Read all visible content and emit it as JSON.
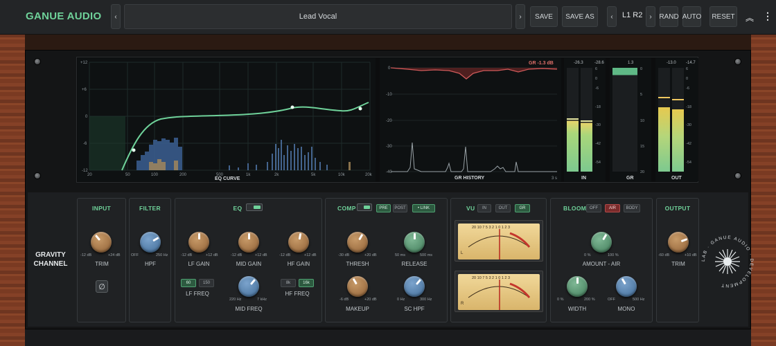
{
  "brand": "GANUE AUDIO",
  "preset": {
    "name": "Lead Vocal",
    "prev": "‹",
    "next": "›"
  },
  "toolbar": {
    "save": "SAVE",
    "save_as": "SAVE AS",
    "slot": "L1 R2",
    "slot_prev": "‹",
    "slot_next": "›",
    "rand": "RAND",
    "auto": "AUTO",
    "reset": "RESET",
    "collapse": "︽",
    "menu": "⋮"
  },
  "eq_curve": {
    "label": "EQ CURVE",
    "y_labels": [
      "+12",
      "+6",
      "0",
      "-6",
      "-12"
    ],
    "x_labels": [
      "20",
      "50",
      "100",
      "200",
      "500",
      "1k",
      "2k",
      "5k",
      "10k",
      "20k"
    ]
  },
  "gr_history": {
    "label": "GR HISTORY",
    "readout": "GR -1.3 dB",
    "y_labels": [
      "0",
      "-10",
      "-20",
      "-30",
      "-40"
    ],
    "x_end": "3 s"
  },
  "meters": {
    "in": {
      "label": "IN",
      "peak_l": "-26.3",
      "peak_r": "-28.6",
      "level_l": 0.49,
      "level_r": 0.47
    },
    "gr": {
      "label": "GR",
      "peak": "1.3",
      "level": 0.07
    },
    "out": {
      "label": "OUT",
      "peak_l": "-13.0",
      "peak_r": "-14.7",
      "level_l": 0.62,
      "level_r": 0.6
    },
    "scale_db": [
      "6",
      "0",
      "-6",
      "-18",
      "-30",
      "-42",
      "-54"
    ],
    "scale_gr": [
      "0",
      "5",
      "10",
      "15",
      "20"
    ]
  },
  "product": {
    "line1": "GRAVITY",
    "line2": "CHANNEL"
  },
  "input": {
    "title": "INPUT",
    "trim_label": "TRIM",
    "min": "-12 dB",
    "max": "+24 dB",
    "phase_icon": "∅"
  },
  "filter": {
    "title": "FILTER",
    "hpf_label": "HPF",
    "min": "OFF",
    "max": "250 Hz"
  },
  "eq": {
    "title": "EQ",
    "lf_gain": {
      "label": "LF GAIN",
      "min": "-12 dB",
      "max": "+12 dB"
    },
    "mid_gain": {
      "label": "MID GAIN",
      "min": "-12 dB",
      "max": "+12 dB"
    },
    "hf_gain": {
      "label": "HF GAIN",
      "min": "-12 dB",
      "max": "+12 dB"
    },
    "lf_freq": {
      "label": "LF FREQ",
      "opt1": "60",
      "opt2": "150"
    },
    "mid_freq": {
      "label": "MID FREQ",
      "min": "220 Hz",
      "max": "7 kHz"
    },
    "hf_freq": {
      "label": "HF FREQ",
      "opt1": "8k",
      "opt2": "16k"
    }
  },
  "comp": {
    "title": "COMP",
    "pre": "PRE",
    "post": "POST",
    "link": "• LINK",
    "thresh": {
      "label": "THRESH",
      "min": "-30 dB",
      "max": "+20 dB"
    },
    "release": {
      "label": "RELEASE",
      "min": "50 ms",
      "max": "500 ms"
    },
    "makeup": {
      "label": "MAKEUP",
      "min": "-6 dB",
      "max": "+20 dB"
    },
    "sc_hpf": {
      "label": "SC HPF",
      "min": "0 Hz",
      "max": "300 Hz"
    }
  },
  "vu": {
    "title": "VU",
    "in": "IN",
    "out": "OUT",
    "gr": "GR",
    "scale": "20 10 7 5 3 2 1 0 1 2 3",
    "l": "L",
    "r": "R"
  },
  "bloom": {
    "title": "BLOOM",
    "off": "OFF",
    "air": "AIR",
    "body": "BODY",
    "amount": {
      "label": "AMOUNT - AIR",
      "min": "0 %",
      "max": "100 %"
    },
    "width": {
      "label": "WIDTH",
      "min": "0 %",
      "max": "200 %"
    },
    "mono": {
      "label": "MONO",
      "min": "OFF",
      "max": "500 Hz"
    }
  },
  "output": {
    "title": "OUTPUT",
    "trim_label": "TRIM",
    "min": "-60 dB",
    "max": "+10 dB"
  },
  "badge": {
    "text": "LAB · GANUE AUDIO · DEVELOPMENT"
  },
  "colors": {
    "accent": "#6fd29a",
    "eq_line": "#6fd29a",
    "gr_line": "#d05a5a",
    "spectrum": "#4a7fb8"
  }
}
